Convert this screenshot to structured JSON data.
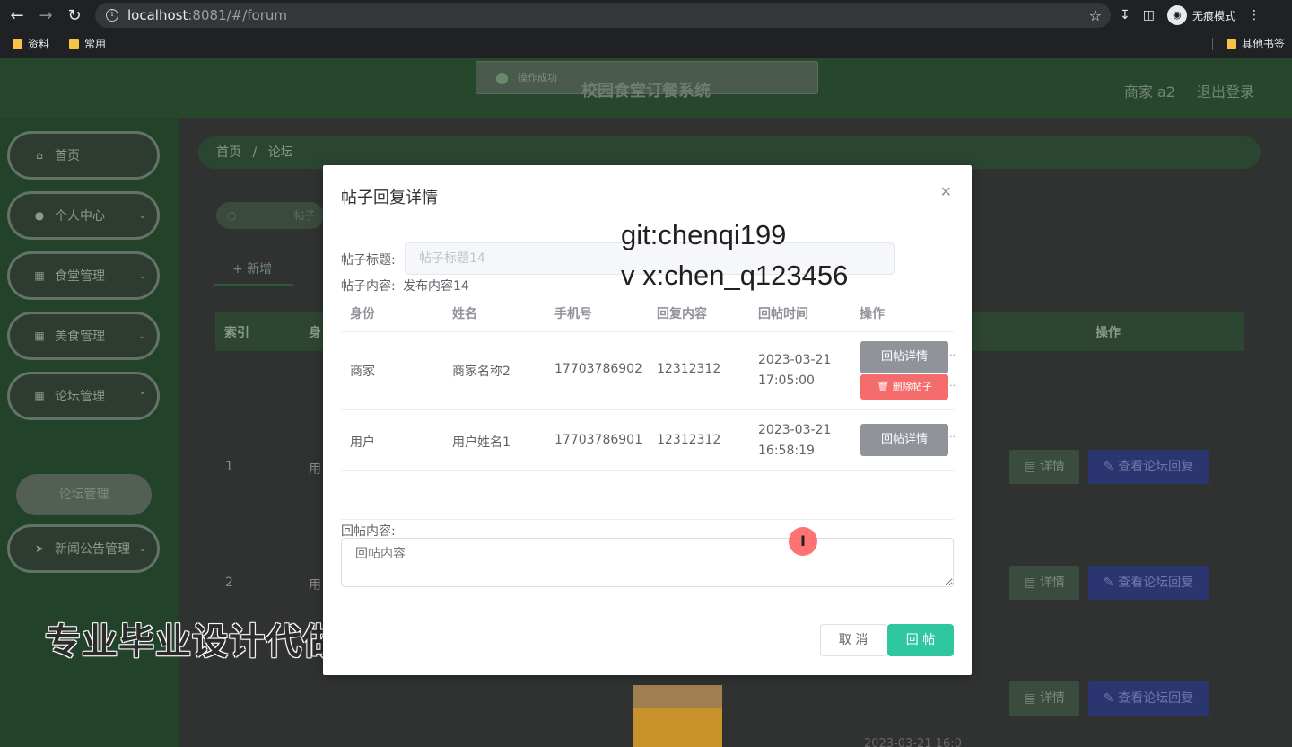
{
  "browser": {
    "url_host": "localhost",
    "url_path": ":8081/#/forum",
    "incognito_label": "无痕模式",
    "bookmarks": [
      "资料",
      "常用"
    ],
    "other_bookmarks": "其他书签"
  },
  "app": {
    "title": "校园食堂订餐系统",
    "user": "商家 a2",
    "logout": "退出登录",
    "toast": "操作成功"
  },
  "sidebar": {
    "items": [
      {
        "label": "首页",
        "icon": "home-icon"
      },
      {
        "label": "个人中心",
        "icon": "user-icon"
      },
      {
        "label": "食堂管理",
        "icon": "grid-icon"
      },
      {
        "label": "美食管理",
        "icon": "grid-icon"
      },
      {
        "label": "论坛管理",
        "icon": "grid-icon"
      },
      {
        "label": "新闻公告管理",
        "icon": "send-icon"
      }
    ],
    "submenu": "论坛管理"
  },
  "main": {
    "breadcrumb_home": "首页",
    "breadcrumb_sep": "/",
    "breadcrumb_current": "论坛",
    "search_placeholder": "帖子",
    "add_tab": "+ 新增",
    "headers": {
      "index": "索引",
      "identity": "身",
      "actions": "操作"
    },
    "rows": [
      {
        "index": "1",
        "name": "用"
      },
      {
        "index": "2",
        "name": "用"
      }
    ],
    "detail_label": "详情",
    "view_reply_label": "查看论坛回复",
    "partial_date": "2023-03-21 16:0"
  },
  "dialog": {
    "title": "帖子回复详情",
    "title_label": "帖子标题:",
    "title_value": "帖子标题14",
    "content_label": "帖子内容:",
    "content_value": "发布内容14",
    "columns": [
      "身份",
      "姓名",
      "手机号",
      "回复内容",
      "回帖时间",
      "操作"
    ],
    "rows": [
      {
        "identity": "商家",
        "name": "商家名称2",
        "phone": "17703786902",
        "reply": "12312312",
        "time": "2023-03-21 17:05:00"
      },
      {
        "identity": "用户",
        "name": "用户姓名1",
        "phone": "17703786901",
        "reply": "12312312",
        "time": "2023-03-21 16:58:19"
      }
    ],
    "row_detail_button": "回帖详情",
    "row_delete_button": "删除帖子",
    "reply_label": "回帖内容:",
    "reply_placeholder": "回帖内容",
    "cancel": "取 消",
    "submit": "回 帖"
  },
  "watermarks": {
    "git": "git:chenqi199",
    "vx": "v x:chen_q123456",
    "promo": "专业毕业设计代做"
  }
}
